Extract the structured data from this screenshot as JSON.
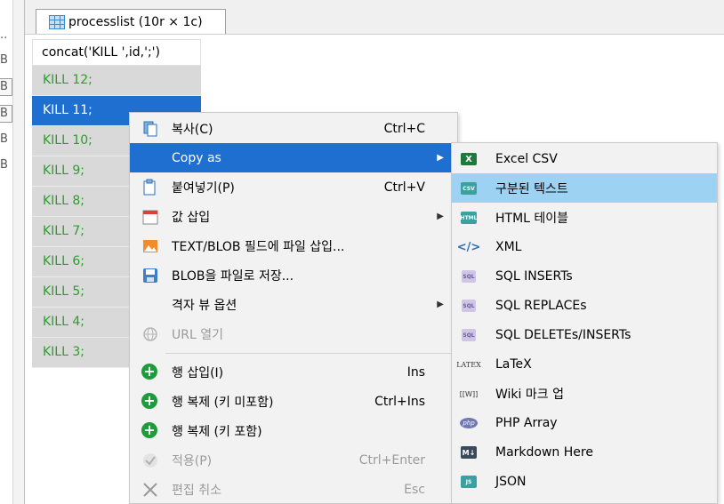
{
  "gutter": {
    "blob_labels": [
      "..",
      "B",
      "B",
      "B",
      "B",
      "B"
    ]
  },
  "tab": {
    "title": "processlist (10r × 1c)"
  },
  "grid": {
    "header": "concat('KILL ',id,';')",
    "rows": [
      "KILL 12;",
      "KILL 11;",
      "KILL 10;",
      "KILL 9;",
      "KILL 8;",
      "KILL 7;",
      "KILL 6;",
      "KILL 5;",
      "KILL 4;",
      "KILL 3;"
    ],
    "selected_index": 1
  },
  "context_menu": {
    "items": [
      {
        "label": "복사(C)",
        "shortcut": "Ctrl+C",
        "icon": "copy-icon"
      },
      {
        "label": "Copy as",
        "shortcut": "",
        "icon": "",
        "submenu": true
      },
      {
        "label": "붙여넣기(P)",
        "shortcut": "Ctrl+V",
        "icon": "paste-icon"
      },
      {
        "label": "값 삽입",
        "shortcut": "",
        "icon": "calendar-icon",
        "submenu": true
      },
      {
        "label": "TEXT/BLOB 필드에 파일 삽입...",
        "shortcut": "",
        "icon": "image-icon"
      },
      {
        "label": "BLOB을 파일로 저장...",
        "shortcut": "",
        "icon": "save-icon"
      },
      {
        "label": "격자 뷰 옵션",
        "shortcut": "",
        "icon": "",
        "submenu": true
      },
      {
        "label": "URL 열기",
        "shortcut": "",
        "icon": "globe-icon",
        "disabled": true
      },
      {
        "label": "행 삽입(I)",
        "shortcut": "Ins",
        "icon": "add-icon"
      },
      {
        "label": "행 복제 (키 미포함)",
        "shortcut": "Ctrl+Ins",
        "icon": "add-icon"
      },
      {
        "label": "행 복제 (키 포함)",
        "shortcut": "",
        "icon": "add-icon"
      },
      {
        "label": "적용(P)",
        "shortcut": "Ctrl+Enter",
        "icon": "check-icon",
        "disabled": true
      },
      {
        "label": "편집 취소",
        "shortcut": "Esc",
        "icon": "close-icon",
        "disabled": true
      }
    ]
  },
  "copy_as_submenu": {
    "items": [
      {
        "label": "Excel CSV",
        "icon": "excel-icon",
        "badge": "X"
      },
      {
        "label": "구분된 텍스트",
        "icon": "csv-icon",
        "badge": "CSV"
      },
      {
        "label": "HTML 테이블",
        "icon": "html-icon",
        "badge": "HTML"
      },
      {
        "label": "XML",
        "icon": "xml-icon",
        "badge": "</>"
      },
      {
        "label": "SQL INSERTs",
        "icon": "sql-icon",
        "badge": "SQL"
      },
      {
        "label": "SQL REPLACEs",
        "icon": "sql-icon",
        "badge": "SQL"
      },
      {
        "label": "SQL DELETEs/INSERTs",
        "icon": "sql-icon",
        "badge": "SQL"
      },
      {
        "label": "LaTeX",
        "icon": "latex-icon",
        "badge": "LATEX"
      },
      {
        "label": "Wiki 마크 업",
        "icon": "wiki-icon",
        "badge": "[[W]]"
      },
      {
        "label": "PHP Array",
        "icon": "php-icon",
        "badge": "php"
      },
      {
        "label": "Markdown Here",
        "icon": "markdown-icon",
        "badge": "M↓"
      },
      {
        "label": "JSON",
        "icon": "json-icon",
        "badge": "JS"
      }
    ],
    "highlighted_index": 1
  },
  "colors": {
    "selection": "#1f6fd0",
    "submenu_highlight": "#9ed2f2",
    "row_text": "#2f9b2f",
    "row_bg": "#d9d9d9"
  }
}
